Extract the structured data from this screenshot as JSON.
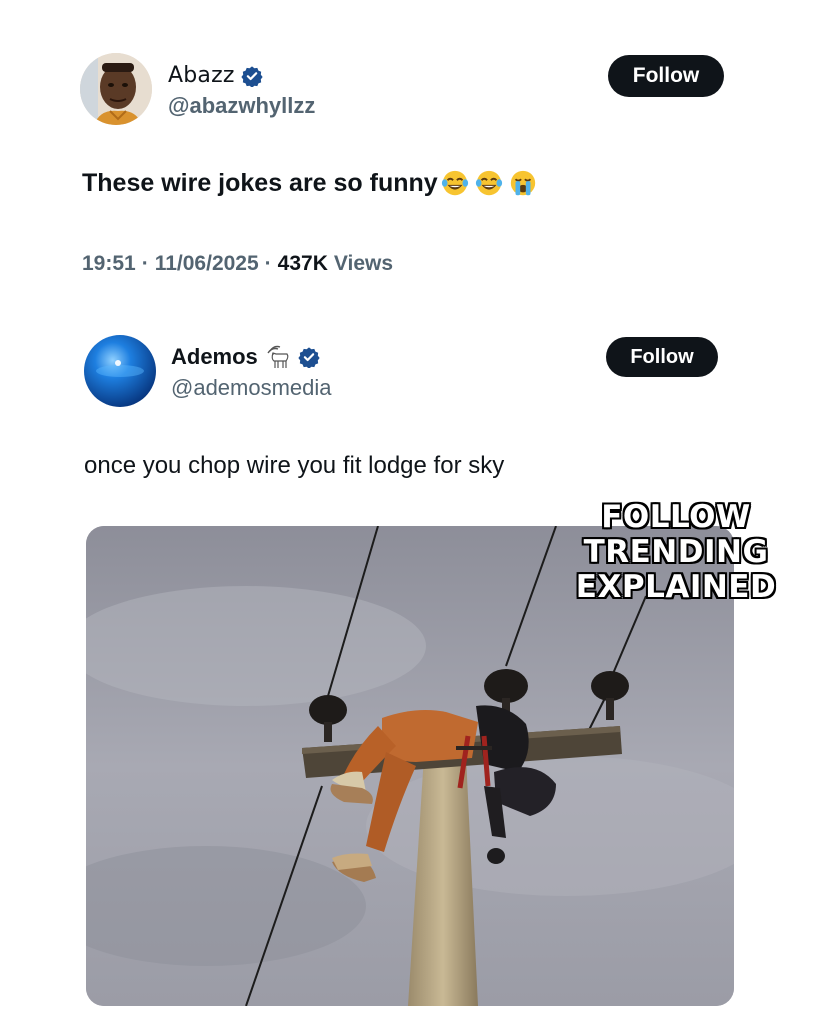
{
  "tweet": {
    "author": {
      "display_name": "Abazz",
      "handle": "@abazwhyllzz",
      "verified_icon": "verified-badge-icon"
    },
    "follow_label": "Follow",
    "text": "These wire jokes are so funny",
    "emojis": [
      "face-with-tears-of-joy",
      "face-with-tears-of-joy",
      "loudly-crying-face"
    ],
    "time": "19:51",
    "date": "11/06/2025",
    "views_count": "437K",
    "views_label": "Views",
    "separator": "·"
  },
  "quoted_tweet": {
    "author": {
      "display_name": "Ademos",
      "handle": "@ademosmedia",
      "name_emoji": "goat-icon",
      "verified_icon": "verified-badge-icon"
    },
    "follow_label": "Follow",
    "text": "once you chop wire you fit lodge for sky"
  },
  "watermark": {
    "lines": [
      "FOLLOW",
      "TRENDING",
      "EXPLAINED"
    ]
  },
  "colors": {
    "text_primary": "#0f1419",
    "text_secondary": "#536471",
    "button_bg": "#0f1419",
    "verified_blue": "#1d4f91"
  }
}
